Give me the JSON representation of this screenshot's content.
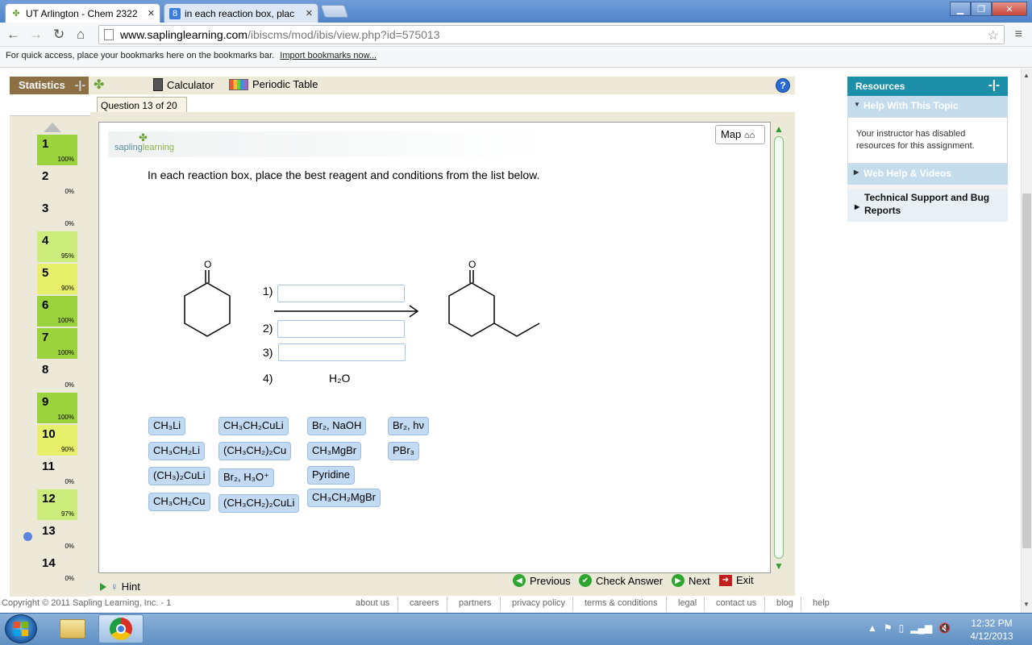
{
  "browser": {
    "tabs": [
      {
        "label": "UT Arlington - Chem 2322",
        "active": true
      },
      {
        "label": "in each reaction box, plac",
        "active": false
      }
    ],
    "url_host": "www.saplinglearning.com",
    "url_path": "/ibiscms/mod/ibis/view.php?id=575013",
    "bookmarks_text": "For quick access, place your bookmarks here on the bookmarks bar.",
    "bookmarks_link": "Import bookmarks now..."
  },
  "app": {
    "statistics_label": "Statistics",
    "calculator_label": "Calculator",
    "periodic_label": "Periodic Table",
    "question_tab": "Question 13 of 20",
    "map_label": "Map",
    "logo_text_a": "sapling",
    "logo_text_b": "learning",
    "prompt": "In each reaction box, place the best reagent and conditions from the list below."
  },
  "questions": [
    {
      "num": "1",
      "pct": "100%",
      "status": "green"
    },
    {
      "num": "2",
      "pct": "0%",
      "status": "gray"
    },
    {
      "num": "3",
      "pct": "0%",
      "status": "gray"
    },
    {
      "num": "4",
      "pct": "95%",
      "status": "lgreen"
    },
    {
      "num": "5",
      "pct": "90%",
      "status": "yellow"
    },
    {
      "num": "6",
      "pct": "100%",
      "status": "green"
    },
    {
      "num": "7",
      "pct": "100%",
      "status": "green"
    },
    {
      "num": "8",
      "pct": "0%",
      "status": "gray"
    },
    {
      "num": "9",
      "pct": "100%",
      "status": "green"
    },
    {
      "num": "10",
      "pct": "90%",
      "status": "yellow"
    },
    {
      "num": "11",
      "pct": "0%",
      "status": "gray"
    },
    {
      "num": "12",
      "pct": "97%",
      "status": "lgreen"
    },
    {
      "num": "13",
      "pct": "0%",
      "status": "gray"
    },
    {
      "num": "14",
      "pct": "0%",
      "status": "gray"
    }
  ],
  "reaction": {
    "step1": "1)",
    "step2": "2)",
    "step3": "3)",
    "step4": "4)",
    "step4_reagent": "H₂O",
    "oxygen_label": "O"
  },
  "reagents": [
    "CH₃Li",
    "CH₃CH₂CuLi",
    "Br₂, NaOH",
    "Br₂, hν",
    "CH₃CH₂Li",
    "(CH₃CH₂)₂Cu",
    "CH₃MgBr",
    "PBr₃",
    "(CH₃)₂CuLi",
    "Br₂, H₃O⁺",
    "Pyridine",
    "CH₃CH₂Cu",
    "(CH₃CH₂)₂CuLi",
    "CH₃CH₂MgBr"
  ],
  "nav": {
    "hint": "Hint",
    "previous": "Previous",
    "check": "Check Answer",
    "next": "Next",
    "exit": "Exit"
  },
  "resources": {
    "title": "Resources",
    "help_topic": "Help With This Topic",
    "disabled_text": "Your instructor has disabled resources for this assignment.",
    "web_help": "Web Help & Videos",
    "tech_support": "Technical Support and Bug Reports"
  },
  "footer": {
    "copyright": "Copyright © 2011 Sapling Learning, Inc. - 1",
    "links": [
      "about us",
      "careers",
      "partners",
      "privacy policy",
      "terms & conditions",
      "legal",
      "contact us",
      "blog",
      "help"
    ]
  },
  "taskbar": {
    "time": "12:32 PM",
    "date": "4/12/2013"
  }
}
